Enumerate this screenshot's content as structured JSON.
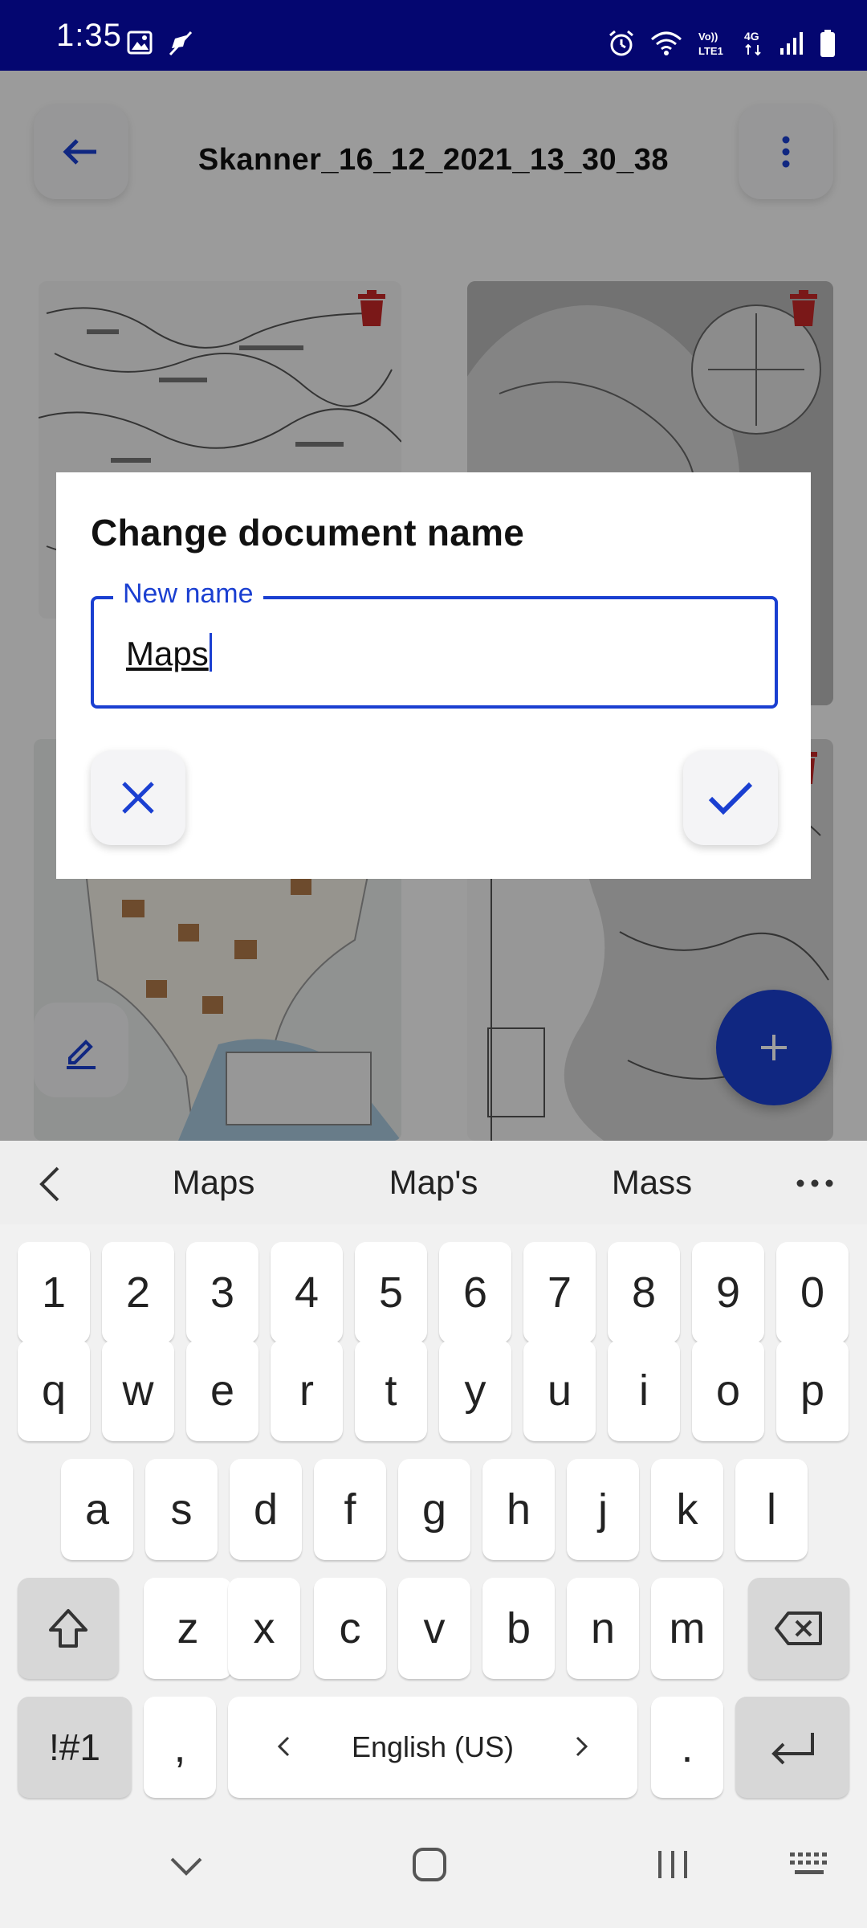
{
  "status_bar": {
    "time": "1:35",
    "icons_left": [
      "gallery-icon",
      "mute-icon"
    ],
    "icons_right": [
      "alarm-icon",
      "wifi-icon",
      "volte-icon",
      "4g-icon",
      "signal-icon",
      "battery-icon"
    ],
    "volte_label": "Vo))\nLTE1",
    "network_label": "4G"
  },
  "header": {
    "title": "Skanner_16_12_2021_13_30_38"
  },
  "dialog": {
    "title": "Change document name",
    "field_label": "New name",
    "field_value": "Maps"
  },
  "keyboard": {
    "suggestions": [
      "Maps",
      "Map's",
      "Mass"
    ],
    "number_row": [
      "1",
      "2",
      "3",
      "4",
      "5",
      "6",
      "7",
      "8",
      "9",
      "0"
    ],
    "row1": [
      "q",
      "w",
      "e",
      "r",
      "t",
      "y",
      "u",
      "i",
      "o",
      "p"
    ],
    "row2": [
      "a",
      "s",
      "d",
      "f",
      "g",
      "h",
      "j",
      "k",
      "l"
    ],
    "row3": [
      "z",
      "x",
      "c",
      "v",
      "b",
      "n",
      "m"
    ],
    "symbols_label": "!#1",
    "comma_label": ",",
    "space_label": "English (US)",
    "period_label": "."
  },
  "colors": {
    "status_bar": "#040670",
    "accent": "#1a3fd1",
    "trash": "#c62828"
  }
}
